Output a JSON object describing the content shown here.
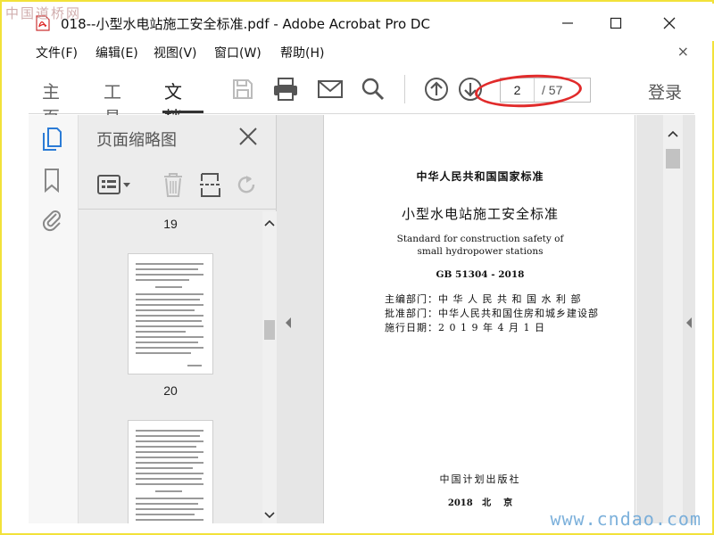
{
  "window": {
    "title": "018--小型水电站施工安全标准.pdf - Adobe Acrobat Pro DC",
    "minimize_glyph": "—",
    "maximize_glyph": "☐",
    "close_glyph": "✕"
  },
  "watermarks": {
    "top_left": "中国道桥网",
    "bottom_right": "www.cndao.com"
  },
  "menu": {
    "items": [
      "文件(F)",
      "编辑(E)",
      "视图(V)",
      "窗口(W)",
      "帮助(H)"
    ],
    "close_glyph": "×"
  },
  "toolbar": {
    "tabs": [
      "主页",
      "工具",
      "文档"
    ],
    "active_tab": "文档",
    "current_page": "2",
    "total_pages": "/ 57",
    "login_label": "登录",
    "highlight_color": "#e12b2b"
  },
  "thumb_panel": {
    "title": "页面缩略图",
    "page_labels": [
      "19",
      "20"
    ]
  },
  "document": {
    "header": "中华人民共和国国家标准",
    "title_cn": "小型水电站施工安全标准",
    "title_en_line1": "Standard for construction safety of",
    "title_en_line2": "small hydropower stations",
    "code": "GB 51304 - 2018",
    "chief_dept": "主编部门：中 华 人 民 共 和 国 水 利 部",
    "approve_dept": "批准部门：中华人民共和国住房和城乡建设部",
    "effective_date": "施行日期：2 0 1 9 年 4 月 1 日",
    "publisher": "中国计划出版社",
    "place_year": "2018   北    京"
  }
}
